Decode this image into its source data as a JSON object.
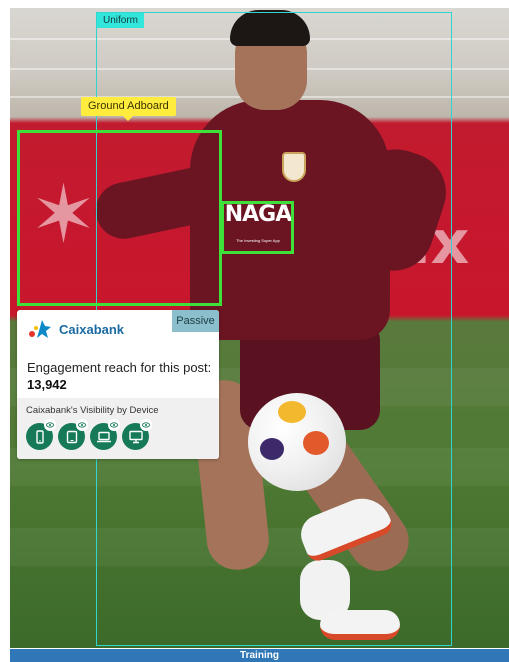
{
  "annotations": {
    "uniform_label": "Uniform",
    "ground_label": "Ground Adboard"
  },
  "photo_text": {
    "shirt_sponsor": "NAGA",
    "shirt_sponsor_tagline": "The Investing Super App"
  },
  "card": {
    "brand_name": "Caixabank",
    "status_badge": "Passive",
    "reach_label": "Engagement reach for this post:",
    "reach_value": "13,942",
    "devices_title": "Caixabank's Visibility by Device",
    "devices": [
      {
        "name": "mobile",
        "icon": "phone-icon"
      },
      {
        "name": "tablet",
        "icon": "tablet-icon"
      },
      {
        "name": "laptop",
        "icon": "laptop-icon"
      },
      {
        "name": "desktop",
        "icon": "desktop-icon"
      }
    ]
  },
  "footer": {
    "label": "Training"
  },
  "colors": {
    "uniform_box": "#2fd6d0",
    "detection_box": "#3ee03a",
    "ground_tag": "#ffec3d",
    "badge": "#8bbfcc",
    "device_button": "#167a58",
    "brand_text": "#1a6aa3",
    "footer_bar": "#2f77b7"
  }
}
